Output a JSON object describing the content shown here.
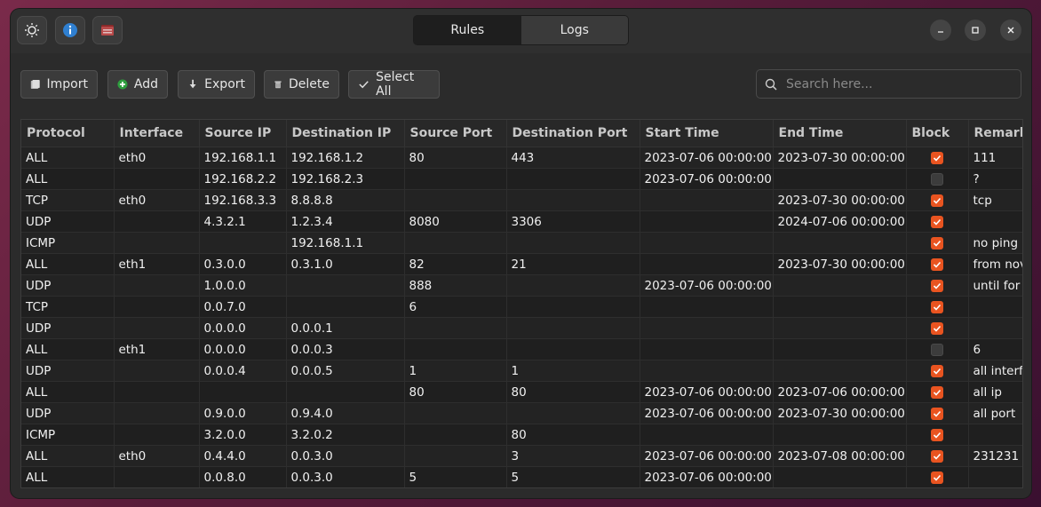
{
  "header": {
    "tabs": [
      {
        "label": "Rules",
        "active": true
      },
      {
        "label": "Logs",
        "active": false
      }
    ],
    "left_icons": [
      "theme-icon",
      "info-icon",
      "folder-icon"
    ],
    "window_controls": [
      "minimize-icon",
      "maximize-icon",
      "close-icon"
    ]
  },
  "toolbar": {
    "import_label": "Import",
    "add_label": "Add",
    "export_label": "Export",
    "delete_label": "Delete",
    "select_all_label": "Select All"
  },
  "search": {
    "placeholder": "Search here...",
    "value": ""
  },
  "colors": {
    "accent": "#e95420",
    "add_green": "#2e9e3e",
    "info_blue": "#2f7fd0"
  },
  "table": {
    "columns": [
      "Protocol",
      "Interface",
      "Source IP",
      "Destination IP",
      "Source Port",
      "Destination Port",
      "Start Time",
      "End Time",
      "Block",
      "Remark"
    ],
    "rows": [
      {
        "protocol": "ALL",
        "interface": "eth0",
        "src_ip": "192.168.1.1",
        "dst_ip": "192.168.1.2",
        "src_port": "80",
        "dst_port": "443",
        "start": "2023-07-06 00:00:00",
        "end": "2023-07-30 00:00:00",
        "block": true,
        "remark": "111"
      },
      {
        "protocol": "ALL",
        "interface": "",
        "src_ip": "192.168.2.2",
        "dst_ip": "192.168.2.3",
        "src_port": "",
        "dst_port": "",
        "start": "2023-07-06 00:00:00",
        "end": "",
        "block": false,
        "remark": "?"
      },
      {
        "protocol": "TCP",
        "interface": "eth0",
        "src_ip": "192.168.3.3",
        "dst_ip": "8.8.8.8",
        "src_port": "",
        "dst_port": "",
        "start": "",
        "end": "2023-07-30 00:00:00",
        "block": true,
        "remark": "tcp"
      },
      {
        "protocol": "UDP",
        "interface": "",
        "src_ip": "4.3.2.1",
        "dst_ip": "1.2.3.4",
        "src_port": "8080",
        "dst_port": "3306",
        "start": "",
        "end": "2024-07-06 00:00:00",
        "block": true,
        "remark": ""
      },
      {
        "protocol": "ICMP",
        "interface": "",
        "src_ip": "",
        "dst_ip": "192.168.1.1",
        "src_port": "",
        "dst_port": "",
        "start": "",
        "end": "",
        "block": true,
        "remark": "no ping a"
      },
      {
        "protocol": "ALL",
        "interface": "eth1",
        "src_ip": "0.3.0.0",
        "dst_ip": "0.3.1.0",
        "src_port": "82",
        "dst_port": "21",
        "start": "",
        "end": "2023-07-30 00:00:00",
        "block": true,
        "remark": "from nov"
      },
      {
        "protocol": "UDP",
        "interface": "",
        "src_ip": "1.0.0.0",
        "dst_ip": "",
        "src_port": "888",
        "dst_port": "",
        "start": "2023-07-06 00:00:00",
        "end": "",
        "block": true,
        "remark": "until for"
      },
      {
        "protocol": "TCP",
        "interface": "",
        "src_ip": "0.0.7.0",
        "dst_ip": "",
        "src_port": "6",
        "dst_port": "",
        "start": "",
        "end": "",
        "block": true,
        "remark": ""
      },
      {
        "protocol": "UDP",
        "interface": "",
        "src_ip": "0.0.0.0",
        "dst_ip": "0.0.0.1",
        "src_port": "",
        "dst_port": "",
        "start": "",
        "end": "",
        "block": true,
        "remark": ""
      },
      {
        "protocol": "ALL",
        "interface": "eth1",
        "src_ip": "0.0.0.0",
        "dst_ip": "0.0.0.3",
        "src_port": "",
        "dst_port": "",
        "start": "",
        "end": "",
        "block": false,
        "remark": "6"
      },
      {
        "protocol": "UDP",
        "interface": "",
        "src_ip": "0.0.0.4",
        "dst_ip": "0.0.0.5",
        "src_port": "1",
        "dst_port": "1",
        "start": "",
        "end": "",
        "block": true,
        "remark": "all interf"
      },
      {
        "protocol": "ALL",
        "interface": "",
        "src_ip": "",
        "dst_ip": "",
        "src_port": "80",
        "dst_port": "80",
        "start": "2023-07-06 00:00:00",
        "end": "2023-07-06 00:00:00",
        "block": true,
        "remark": "all ip"
      },
      {
        "protocol": "UDP",
        "interface": "",
        "src_ip": "0.9.0.0",
        "dst_ip": "0.9.4.0",
        "src_port": "",
        "dst_port": "",
        "start": "2023-07-06 00:00:00",
        "end": "2023-07-30 00:00:00",
        "block": true,
        "remark": "all port"
      },
      {
        "protocol": "ICMP",
        "interface": "",
        "src_ip": "3.2.0.0",
        "dst_ip": "3.2.0.2",
        "src_port": "",
        "dst_port": "80",
        "start": "",
        "end": "",
        "block": true,
        "remark": ""
      },
      {
        "protocol": "ALL",
        "interface": "eth0",
        "src_ip": "0.4.4.0",
        "dst_ip": "0.0.3.0",
        "src_port": "",
        "dst_port": "3",
        "start": "2023-07-06 00:00:00",
        "end": "2023-07-08 00:00:00",
        "block": true,
        "remark": "231231"
      },
      {
        "protocol": "ALL",
        "interface": "",
        "src_ip": "0.0.8.0",
        "dst_ip": "0.0.3.0",
        "src_port": "5",
        "dst_port": "5",
        "start": "2023-07-06 00:00:00",
        "end": "",
        "block": true,
        "remark": ""
      }
    ]
  }
}
